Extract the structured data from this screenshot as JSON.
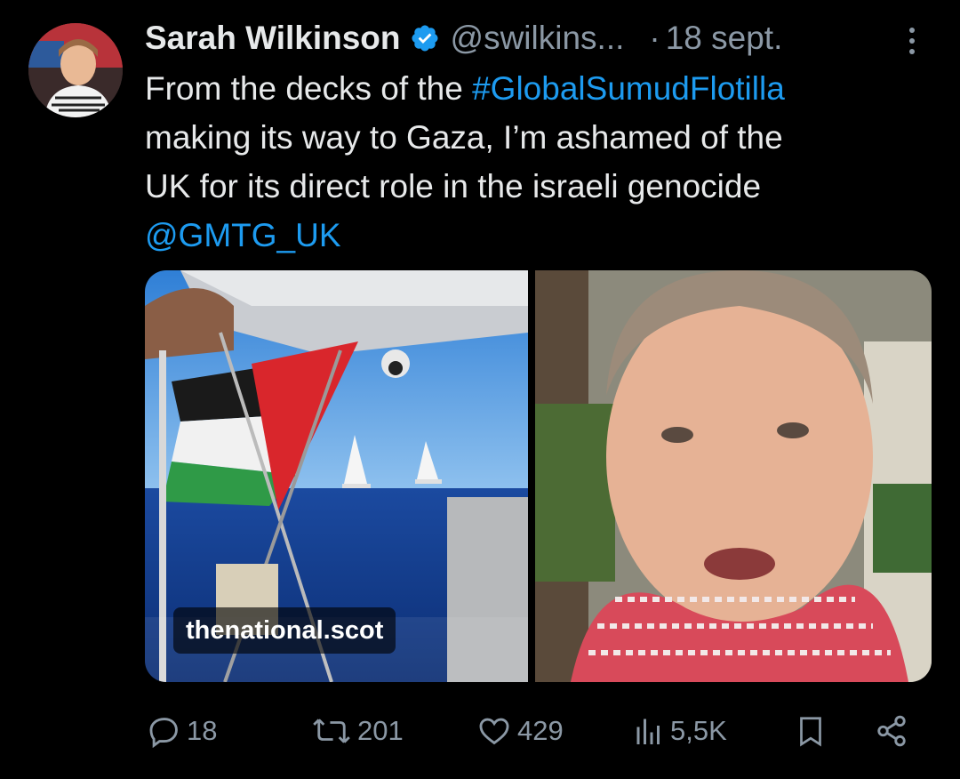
{
  "tweet": {
    "author_name": "Sarah Wilkinson",
    "handle": "@swilkins...",
    "dot": "·",
    "time": "18 sept.",
    "text_lines": [
      {
        "pre": "From the decks of the ",
        "link": "#GlobalSumudFlotilla"
      },
      {
        "pre": "making its way to Gaza, I’m ashamed of the"
      },
      {
        "pre": "UK for its direct role in the israeli genocide"
      },
      {
        "link": "@GMTG_UK"
      }
    ],
    "media_source": "thenational.scot"
  },
  "actions": {
    "replies": "18",
    "reposts": "201",
    "likes": "429",
    "views": "5,5K"
  },
  "colors": {
    "background": "#000000",
    "text": "#e7e9ea",
    "muted": "#8b98a5",
    "link": "#1d9bf0",
    "verified": "#1d9bf0"
  },
  "icons": [
    "more-icon",
    "verified-badge-icon",
    "reply-icon",
    "repost-icon",
    "like-icon",
    "views-icon",
    "bookmark-icon",
    "share-icon"
  ]
}
